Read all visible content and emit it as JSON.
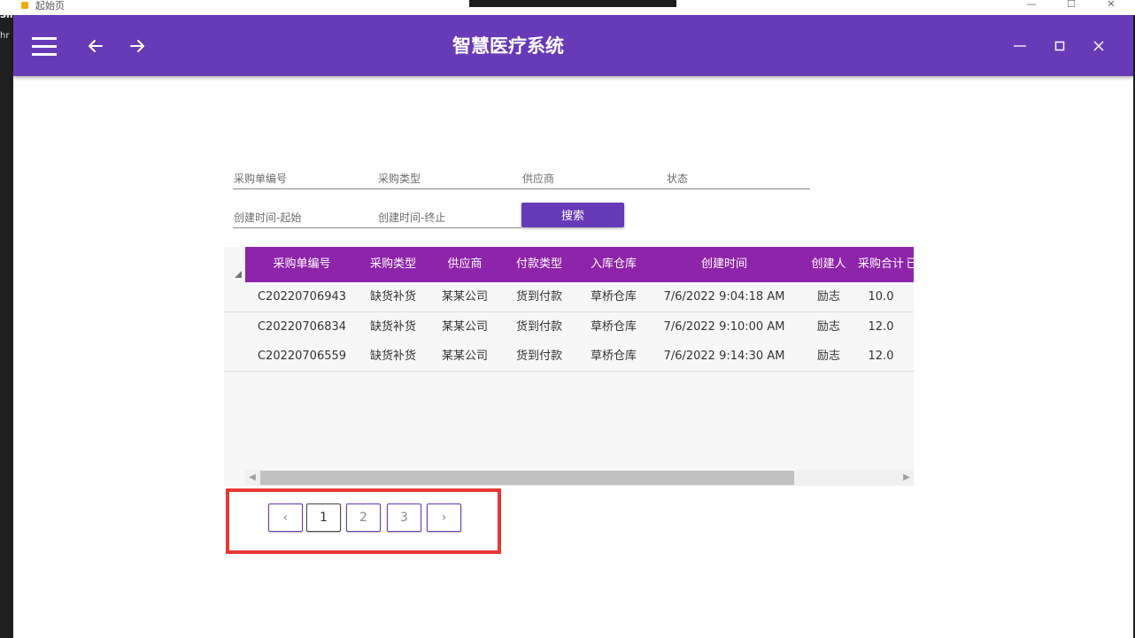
{
  "os": {
    "title": "起始页",
    "controls": [
      "—",
      "☐",
      "✕"
    ]
  },
  "left_strip": {
    "texts": [
      "Sh.",
      "hr"
    ]
  },
  "appbar": {
    "title": "智慧医疗系统",
    "bg": "#673ab7"
  },
  "filters": {
    "purchase_no": "采购单编号",
    "purchase_type": "采购类型",
    "supplier": "供应商",
    "status": "状态",
    "created_start": "创建时间-起始",
    "created_end": "创建时间-终止",
    "search_label": "搜索"
  },
  "grid": {
    "header_bg": "#8e24aa",
    "columns": [
      "采购单编号",
      "采购类型",
      "供应商",
      "付款类型",
      "入库仓库",
      "创建时间",
      "创建人",
      "采购合计",
      "已"
    ],
    "rows": [
      [
        "C20220706943",
        "缺货补货",
        "某某公司",
        "货到付款",
        "草桥仓库",
        "7/6/2022 9:04:18 AM",
        "励志",
        "10.0"
      ],
      [
        "C20220706834",
        "缺货补货",
        "某某公司",
        "货到付款",
        "草桥仓库",
        "7/6/2022 9:10:00 AM",
        "励志",
        "12.0"
      ],
      [
        "C20220706559",
        "缺货补货",
        "某某公司",
        "货到付款",
        "草桥仓库",
        "7/6/2022 9:14:30 AM",
        "励志",
        "12.0"
      ]
    ]
  },
  "pagination": {
    "prev": "‹",
    "pages": [
      "1",
      "2",
      "3"
    ],
    "next": "›",
    "current": "1"
  },
  "highlight_color": "#e53935"
}
